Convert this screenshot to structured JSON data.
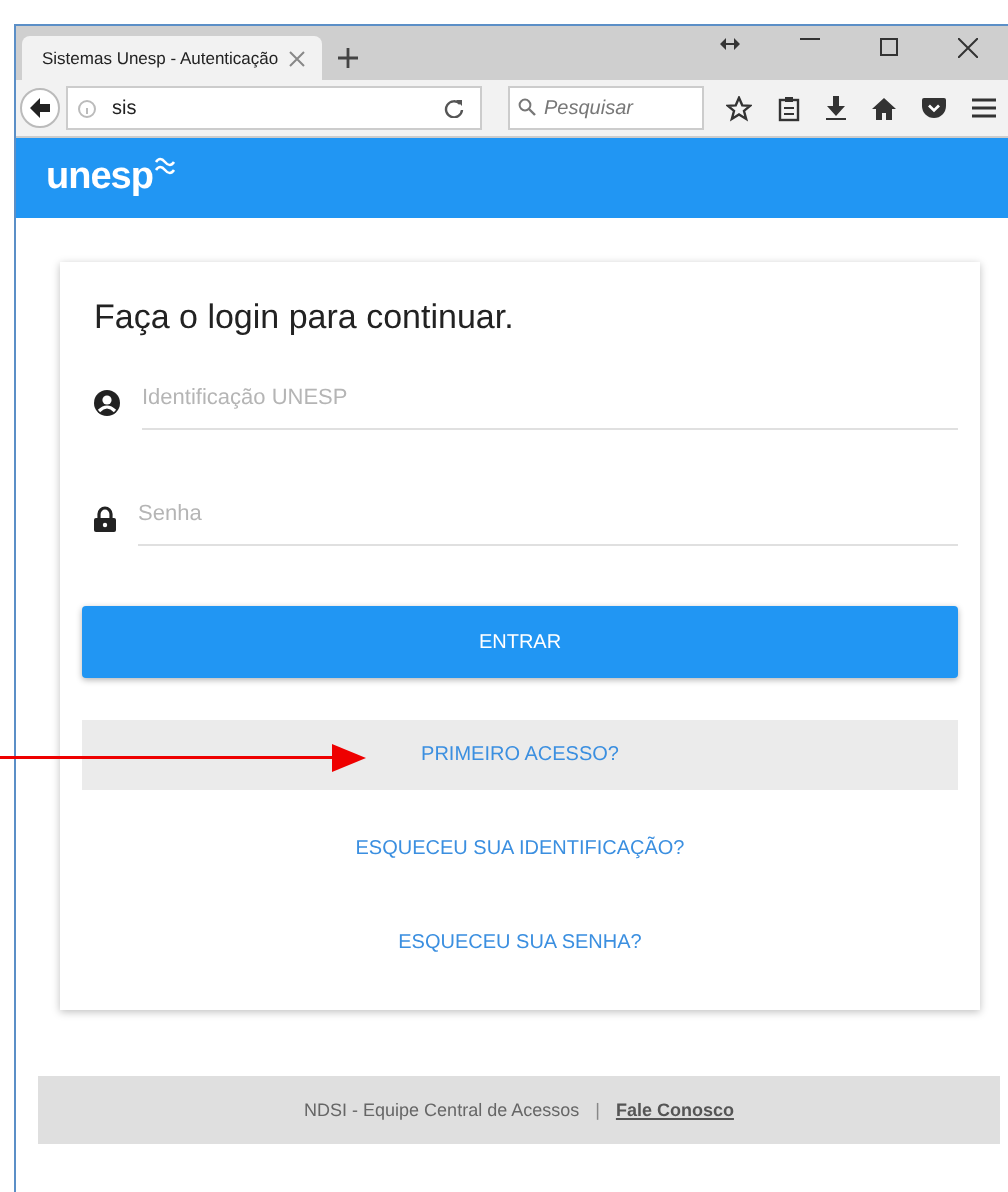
{
  "browser": {
    "tab": {
      "title": "Sistemas Unesp - Autenticação"
    },
    "address": "sis",
    "search": {
      "placeholder": "Pesquisar"
    }
  },
  "header": {
    "logo": "unesp"
  },
  "login": {
    "title": "Faça o login para continuar.",
    "fields": [
      {
        "kind": "user",
        "placeholder": "Identificação UNESP"
      },
      {
        "kind": "password",
        "placeholder": "Senha"
      }
    ],
    "submit": "ENTRAR",
    "links": [
      {
        "label": "PRIMEIRO ACESSO?",
        "highlighted": true
      },
      {
        "label": "ESQUECEU SUA IDENTIFICAÇÃO?",
        "highlighted": false
      },
      {
        "label": "ESQUECEU SUA SENHA?",
        "highlighted": false
      }
    ]
  },
  "footer": {
    "text": "NDSI - Equipe Central de Acessos",
    "separator": "|",
    "link": "Fale Conosco"
  },
  "annotation": {
    "kind": "arrow"
  }
}
